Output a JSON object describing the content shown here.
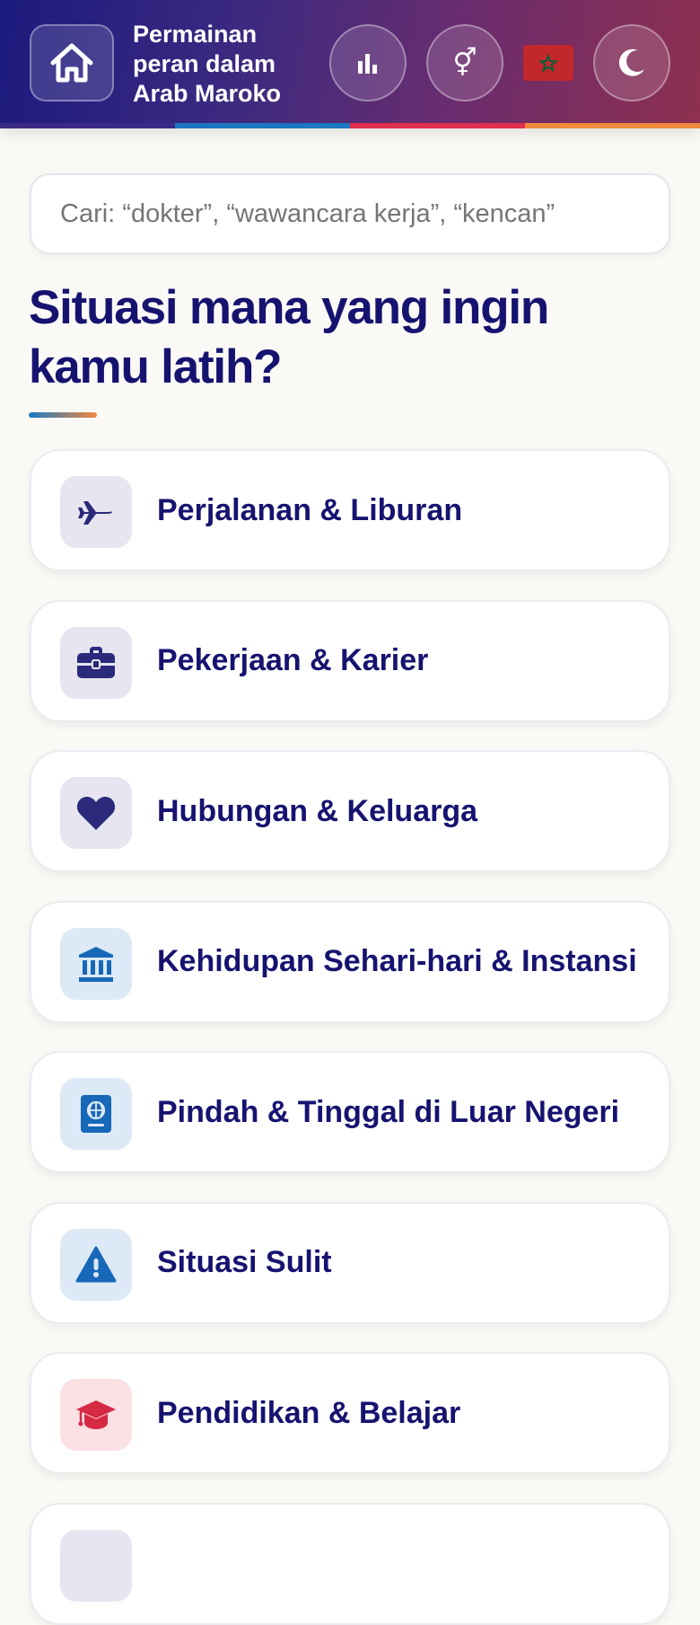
{
  "header": {
    "title": "Permainan peran dalam Arab Maroko",
    "stripe_colors": [
      "#3a2a85",
      "#1a78c2",
      "#e0304e",
      "#f08a3c"
    ]
  },
  "search": {
    "placeholder": "Cari: “dokter”, “wawancara kerja”, “kencan”"
  },
  "main": {
    "heading": "Situasi mana yang ingin kamu latih?"
  },
  "categories": [
    {
      "label": "Perjalanan & Liburan",
      "icon": "airplane-icon",
      "icon_color": "#2b2a7a",
      "tile_color": "#e6e5f0"
    },
    {
      "label": "Pekerjaan & Karier",
      "icon": "briefcase-icon",
      "icon_color": "#2b2a7a",
      "tile_color": "#e6e5f0"
    },
    {
      "label": "Hubungan & Keluarga",
      "icon": "heart-icon",
      "icon_color": "#2b2a7a",
      "tile_color": "#e6e5f0"
    },
    {
      "label": "Kehidupan Sehari-hari & Instansi",
      "icon": "bank-icon",
      "icon_color": "#1768b8",
      "tile_color": "#dde9f6"
    },
    {
      "label": "Pindah & Tinggal di Luar Negeri",
      "icon": "passport-icon",
      "icon_color": "#1768b8",
      "tile_color": "#dde9f6"
    },
    {
      "label": "Situasi Sulit",
      "icon": "warning-icon",
      "icon_color": "#1768b8",
      "tile_color": "#dde9f6"
    },
    {
      "label": "Pendidikan & Belajar",
      "icon": "graduation-cap-icon",
      "icon_color": "#d62a44",
      "tile_color": "#fbe0e4"
    },
    {
      "label": "",
      "icon": "",
      "icon_color": "#2b2a7a",
      "tile_color": "#e6e5f0"
    }
  ]
}
